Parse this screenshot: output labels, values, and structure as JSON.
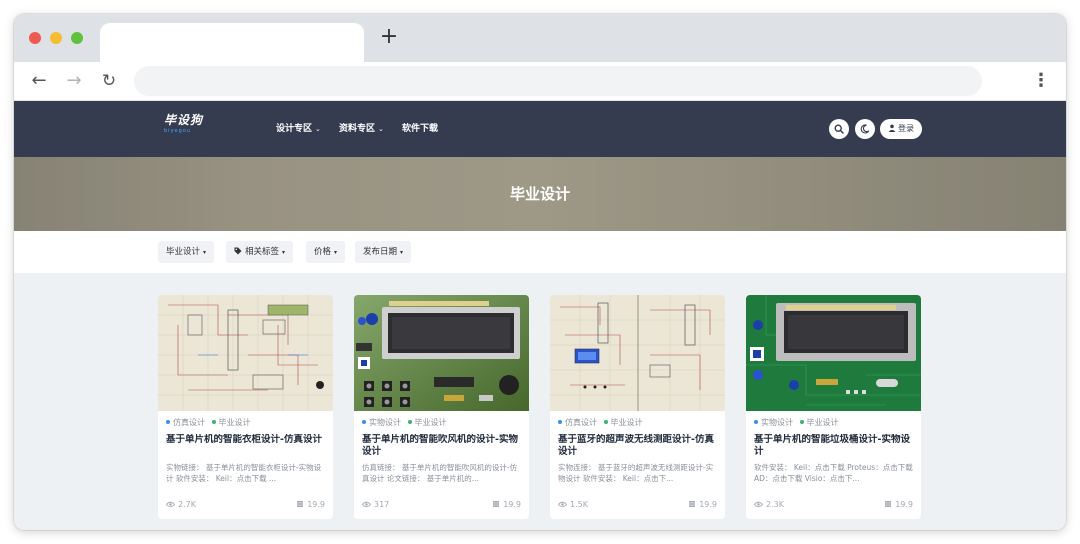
{
  "browser": {
    "new_tab": "+",
    "back": "←",
    "forward": "→",
    "reload": "↻",
    "menu": "⋮"
  },
  "header": {
    "logo_text": "毕设狗",
    "logo_sub": "biyegou",
    "nav": [
      {
        "label": "设计专区",
        "caret": "⌄"
      },
      {
        "label": "资料专区",
        "caret": "⌄"
      },
      {
        "label": "软件下载"
      }
    ],
    "login_label": "登录"
  },
  "banner": {
    "title": "毕业设计"
  },
  "filters": [
    {
      "label": "毕业设计",
      "caret": "▾"
    },
    {
      "label": "相关标签",
      "caret": "▾"
    },
    {
      "label": "价格",
      "caret": "▾"
    },
    {
      "label": "发布日期",
      "caret": "▾"
    }
  ],
  "cards": [
    {
      "tags": [
        "仿真设计",
        "毕业设计"
      ],
      "tag_colors": [
        "#3a8fe8",
        "#3cb46e"
      ],
      "title": "基于单片机的智能衣柜设计-仿真设计",
      "desc": "实物链接： 基于单片机的智能衣柜设计-实物设计 软件安装： Keil：点击下载 ...",
      "views": "2.7K",
      "price": "19.9"
    },
    {
      "tags": [
        "实物设计",
        "毕业设计"
      ],
      "tag_colors": [
        "#3a8fe8",
        "#3cb46e"
      ],
      "title": "基于单片机的智能吹风机的设计-实物设计",
      "desc": "仿真链接： 基于单片机的智能吹风机的设计-仿真设计 论文链接： 基于单片机的...",
      "views": "317",
      "price": "19.9"
    },
    {
      "tags": [
        "仿真设计",
        "毕业设计"
      ],
      "tag_colors": [
        "#3a8fe8",
        "#3cb46e"
      ],
      "title": "基于蓝牙的超声波无线测距设计-仿真设计",
      "desc": "实物连接： 基于蓝牙的超声波无线测距设计-实物设计 软件安装： Keil：点击下...",
      "views": "1.5K",
      "price": "19.9"
    },
    {
      "tags": [
        "实物设计",
        "毕业设计"
      ],
      "tag_colors": [
        "#3a8fe8",
        "#3cb46e"
      ],
      "title": "基于单片机的智能垃圾桶设计-实物设计",
      "desc": "软件安装： Keil：点击下载 Proteus：点击下载 AD：点击下载 Visio：点击下...",
      "views": "2.3K",
      "price": "19.9"
    }
  ],
  "colors": {
    "header_bg": "#363c50",
    "accent_blue": "#3a8fe8",
    "accent_green": "#3cb46e"
  }
}
